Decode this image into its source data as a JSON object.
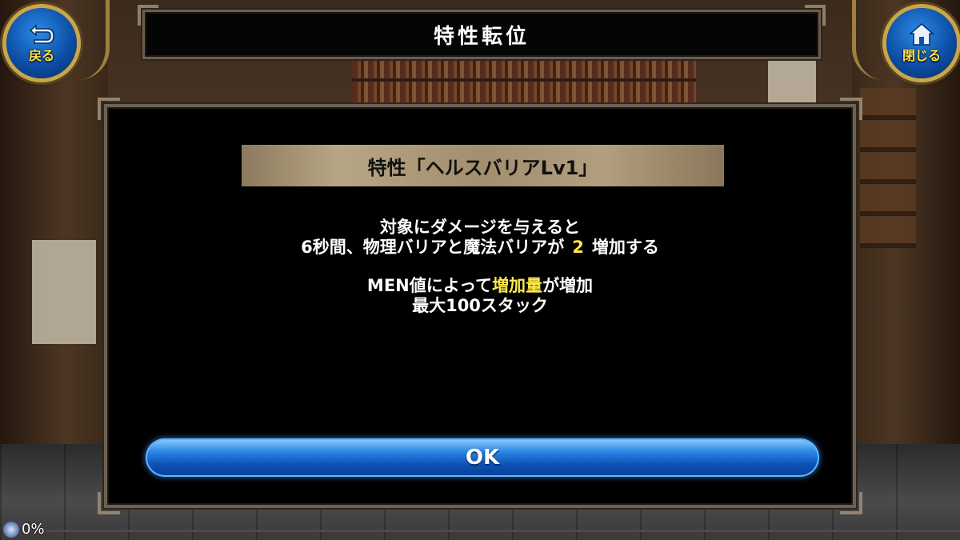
{
  "header": {
    "title": "特性転位",
    "back_label": "戻る",
    "close_label": "閉じる"
  },
  "dialog": {
    "trait_title": "特性「ヘルスバリアLv1」",
    "desc_line1": "対象にダメージを与えると",
    "desc_line2_before": "6秒間、物理バリアと魔法バリアが",
    "desc_line2_value": "2",
    "desc_line2_after": "増加する",
    "desc_line3_before": "MEN値によって",
    "desc_line3_highlight": "増加量",
    "desc_line3_after": "が増加",
    "desc_line4": "最大100スタック",
    "ok_label": "OK"
  },
  "status": {
    "progress_text": "0%",
    "progress_value": 0
  },
  "colors": {
    "highlight": "#ffe84a",
    "button_blue": "#1f6fd6",
    "frame": "#6d6153"
  },
  "icons": {
    "back": "return-arrow-icon",
    "close": "home-icon"
  }
}
